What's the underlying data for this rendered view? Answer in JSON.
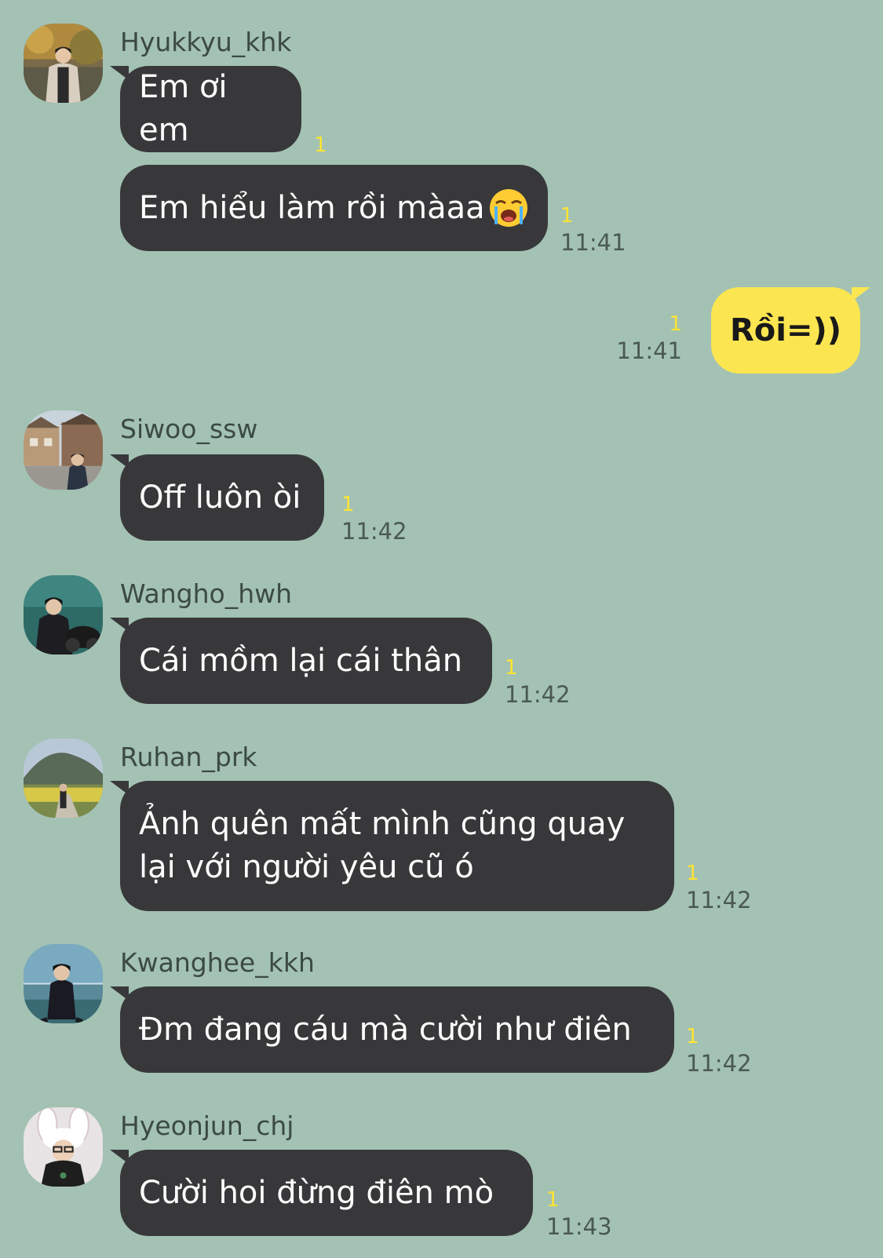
{
  "colors": {
    "background": "#a3c2b3",
    "bubble_other": "#38383a",
    "bubble_mine": "#fbe651",
    "unread": "#fde332",
    "sender_name": "#3c4a44"
  },
  "messages": [
    {
      "sender": "Hyukkyu_khk",
      "avatar": "avatar-hyukkyu",
      "bubbles": [
        {
          "text": "Em ơi em",
          "unread": "1",
          "time": ""
        },
        {
          "text": "Em hiểu làm rồi màaa",
          "emoji": "loudly-crying-face-icon",
          "unread": "1",
          "time": "11:41"
        }
      ]
    },
    {
      "mine": true,
      "text": "Rồi=))",
      "unread": "1",
      "time": "11:41"
    },
    {
      "sender": "Siwoo_ssw",
      "avatar": "avatar-siwoo",
      "bubbles": [
        {
          "text": "Off luôn òi",
          "unread": "1",
          "time": "11:42"
        }
      ]
    },
    {
      "sender": "Wangho_hwh",
      "avatar": "avatar-wangho",
      "bubbles": [
        {
          "text": "Cái mồm lại cái thân",
          "unread": "1",
          "time": "11:42"
        }
      ]
    },
    {
      "sender": "Ruhan_prk",
      "avatar": "avatar-ruhan",
      "bubbles": [
        {
          "text": "Ảnh quên mất mình cũng quay\nlại với người yêu cũ ó",
          "unread": "1",
          "time": "11:42"
        }
      ]
    },
    {
      "sender": "Kwanghee_kkh",
      "avatar": "avatar-kwanghee",
      "bubbles": [
        {
          "text": "Đm đang cáu mà cười như điên",
          "unread": "1",
          "time": "11:42"
        }
      ]
    },
    {
      "sender": "Hyeonjun_chj",
      "avatar": "avatar-hyeonjun",
      "bubbles": [
        {
          "text": "Cười hoi đừng điên mò",
          "unread": "1",
          "time": "11:43"
        }
      ]
    }
  ]
}
